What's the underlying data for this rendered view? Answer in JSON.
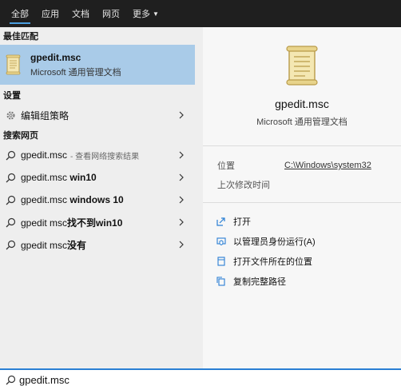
{
  "tabs": [
    {
      "label": "全部"
    },
    {
      "label": "应用"
    },
    {
      "label": "文档"
    },
    {
      "label": "网页"
    },
    {
      "label": "更多"
    }
  ],
  "left": {
    "best_match_header": "最佳匹配",
    "best_match": {
      "title": "gpedit.msc",
      "subtitle": "Microsoft 通用管理文档"
    },
    "settings_header": "设置",
    "settings_item": {
      "label": "编辑组策略"
    },
    "web_header": "搜索网页",
    "web_results": [
      {
        "prefix": "gpedit.msc",
        "bold": "",
        "suffix": "- 查看网络搜索结果"
      },
      {
        "prefix": "gpedit.msc ",
        "bold": "win10",
        "suffix": ""
      },
      {
        "prefix": "gpedit.msc ",
        "bold": "windows 10",
        "suffix": ""
      },
      {
        "prefix": "gpedit msc",
        "bold": "找不到win10",
        "suffix": ""
      },
      {
        "prefix": "gpedit msc",
        "bold": "没有",
        "suffix": ""
      }
    ]
  },
  "right": {
    "name": "gpedit.msc",
    "type": "Microsoft 通用管理文档",
    "location_label": "位置",
    "location_value": "C:\\Windows\\system32",
    "modified_label": "上次修改时间",
    "actions": [
      {
        "label": "打开",
        "icon": "open-icon"
      },
      {
        "label": "以管理员身份运行(A)",
        "icon": "shield-icon"
      },
      {
        "label": "打开文件所在的位置",
        "icon": "file-location-icon"
      },
      {
        "label": "复制完整路径",
        "icon": "copy-icon"
      }
    ]
  },
  "search": {
    "value": "gpedit.msc"
  },
  "colors": {
    "accent": "#2a7fd4",
    "selection": "#a9cbe8",
    "topbar": "#1f1f1f"
  }
}
